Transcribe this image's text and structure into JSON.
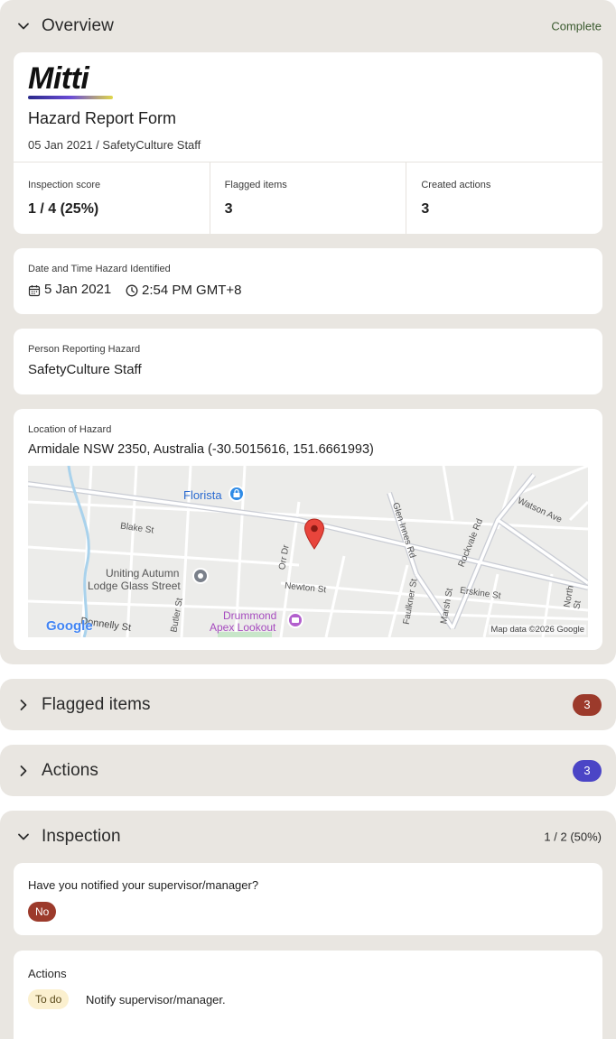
{
  "overview": {
    "title": "Overview",
    "status": "Complete",
    "logo_text": "Mitti",
    "form_title": "Hazard Report Form",
    "subtitle": "05 Jan 2021 / SafetyCulture Staff",
    "metrics": [
      {
        "label": "Inspection score",
        "value": "1 / 4 (25%)"
      },
      {
        "label": "Flagged items",
        "value": "3"
      },
      {
        "label": "Created actions",
        "value": "3"
      }
    ],
    "datetime": {
      "label": "Date and Time Hazard Identified",
      "date": "5 Jan 2021",
      "time": "2:54 PM GMT+8"
    },
    "person": {
      "label": "Person Reporting Hazard",
      "value": "SafetyCulture Staff"
    },
    "location": {
      "label": "Location of Hazard",
      "value": "Armidale NSW 2350, Australia (-30.5015616, 151.6661993)"
    },
    "map": {
      "labels": {
        "florista": "Florista",
        "blake": "Blake St",
        "orr": "Orr Dr",
        "glen": "Glen Innes Rd",
        "rockvale": "Rockvale Rd",
        "watson": "Watson Ave",
        "uniting1": "Uniting Autumn",
        "uniting2": "Lodge Glass Street",
        "newton": "Newton St",
        "faulkner": "Faulkner St",
        "marsh": "Marsh St",
        "erskine": "Erskine St",
        "north": "North St",
        "butler": "Butler St",
        "donnelly": "Donnelly St",
        "drummond1": "Drummond",
        "drummond2": "Apex Lookout",
        "google": "Google",
        "attribution": "Map data ©2026 Google"
      }
    }
  },
  "flagged": {
    "title": "Flagged items",
    "count": "3",
    "color": "#9c3a2b"
  },
  "actions": {
    "title": "Actions",
    "count": "3",
    "color": "#4b45c6"
  },
  "inspection": {
    "title": "Inspection",
    "score": "1 / 2 (50%)",
    "question": "Have you notified your supervisor/manager?",
    "answer": "No",
    "actions_label": "Actions",
    "action_status": "To do",
    "action_text": "Notify supervisor/manager."
  }
}
